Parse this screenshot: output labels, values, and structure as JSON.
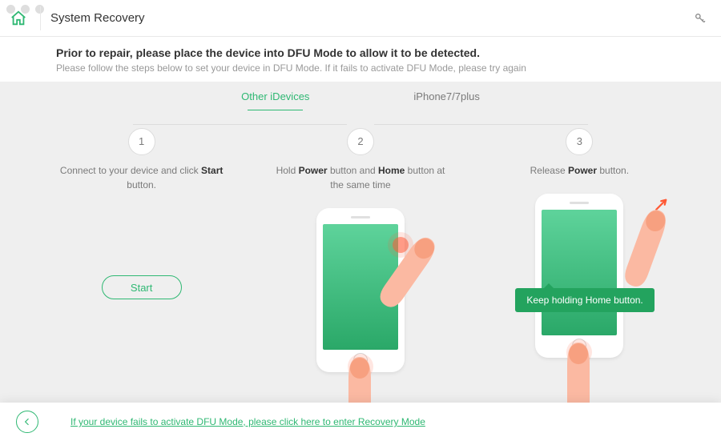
{
  "window": {
    "title": "System Recovery"
  },
  "intro": {
    "heading": "Prior to repair, please place the device into DFU Mode to allow it to be detected.",
    "sub": "Please follow the steps below to set your device in DFU Mode. If it fails to activate DFU Mode, please try again"
  },
  "tabs": {
    "active": 0,
    "items": [
      "Other iDevices",
      "iPhone7/7plus"
    ]
  },
  "steps": {
    "one": {
      "num": "1",
      "pre": "Connect to your device and click ",
      "b1": "Start",
      "post": " button."
    },
    "two": {
      "num": "2",
      "pre": "Hold ",
      "b1": "Power",
      "mid1": " button and ",
      "b2": "Home",
      "post": " button at the same time"
    },
    "three": {
      "num": "3",
      "pre": "Release ",
      "b1": "Power",
      "post": " button."
    }
  },
  "tooltip": "Keep holding Home button.",
  "start_label": "Start",
  "footer_link": "If your device fails to activate DFU Mode, please click here to enter Recovery Mode"
}
